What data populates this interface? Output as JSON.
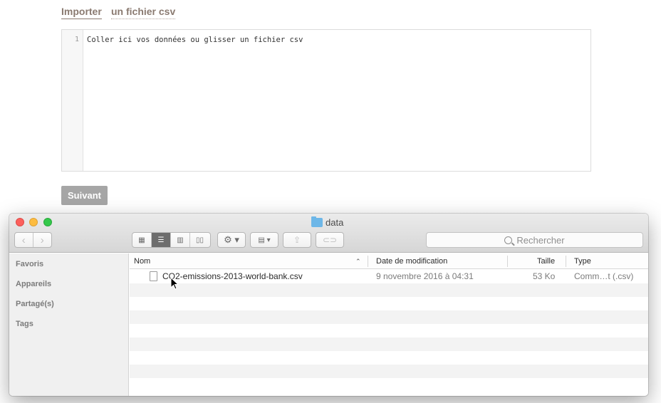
{
  "import": {
    "tab_import": "Importer",
    "tab_file": "un fichier csv",
    "line_number": "1",
    "placeholder": "Coller ici vos données ou glisser un fichier csv",
    "next_label": "Suivant"
  },
  "finder": {
    "title": "data",
    "search_placeholder": "Rechercher",
    "sidebar": [
      {
        "label": "Favoris"
      },
      {
        "label": "Appareils"
      },
      {
        "label": "Partagé(s)"
      },
      {
        "label": "Tags"
      }
    ],
    "columns": {
      "name": "Nom",
      "date": "Date de modification",
      "size": "Taille",
      "type": "Type"
    },
    "files": [
      {
        "name": "CO2-emissions-2013-world-bank.csv",
        "date": "9 novembre 2016 à 04:31",
        "size": "53 Ko",
        "type": "Comm…t (.csv)"
      }
    ],
    "icons": {
      "back": "chevron-left-icon",
      "forward": "chevron-right-icon",
      "views": [
        "icon-view-icon",
        "list-view-icon",
        "column-view-icon",
        "cover-flow-icon"
      ],
      "action": "gear-icon",
      "arrange": "arrange-icon",
      "share": "share-icon",
      "tag": "tag-icon",
      "search": "search-icon",
      "folder": "folder-icon",
      "file": "file-icon"
    }
  },
  "colors": {
    "accent_text": "#8a7a70",
    "button_bg": "#a6a6a6",
    "close": "#fc605c",
    "minimize": "#fdbc40",
    "maximize": "#34c84a",
    "folder": "#6db7e8"
  }
}
